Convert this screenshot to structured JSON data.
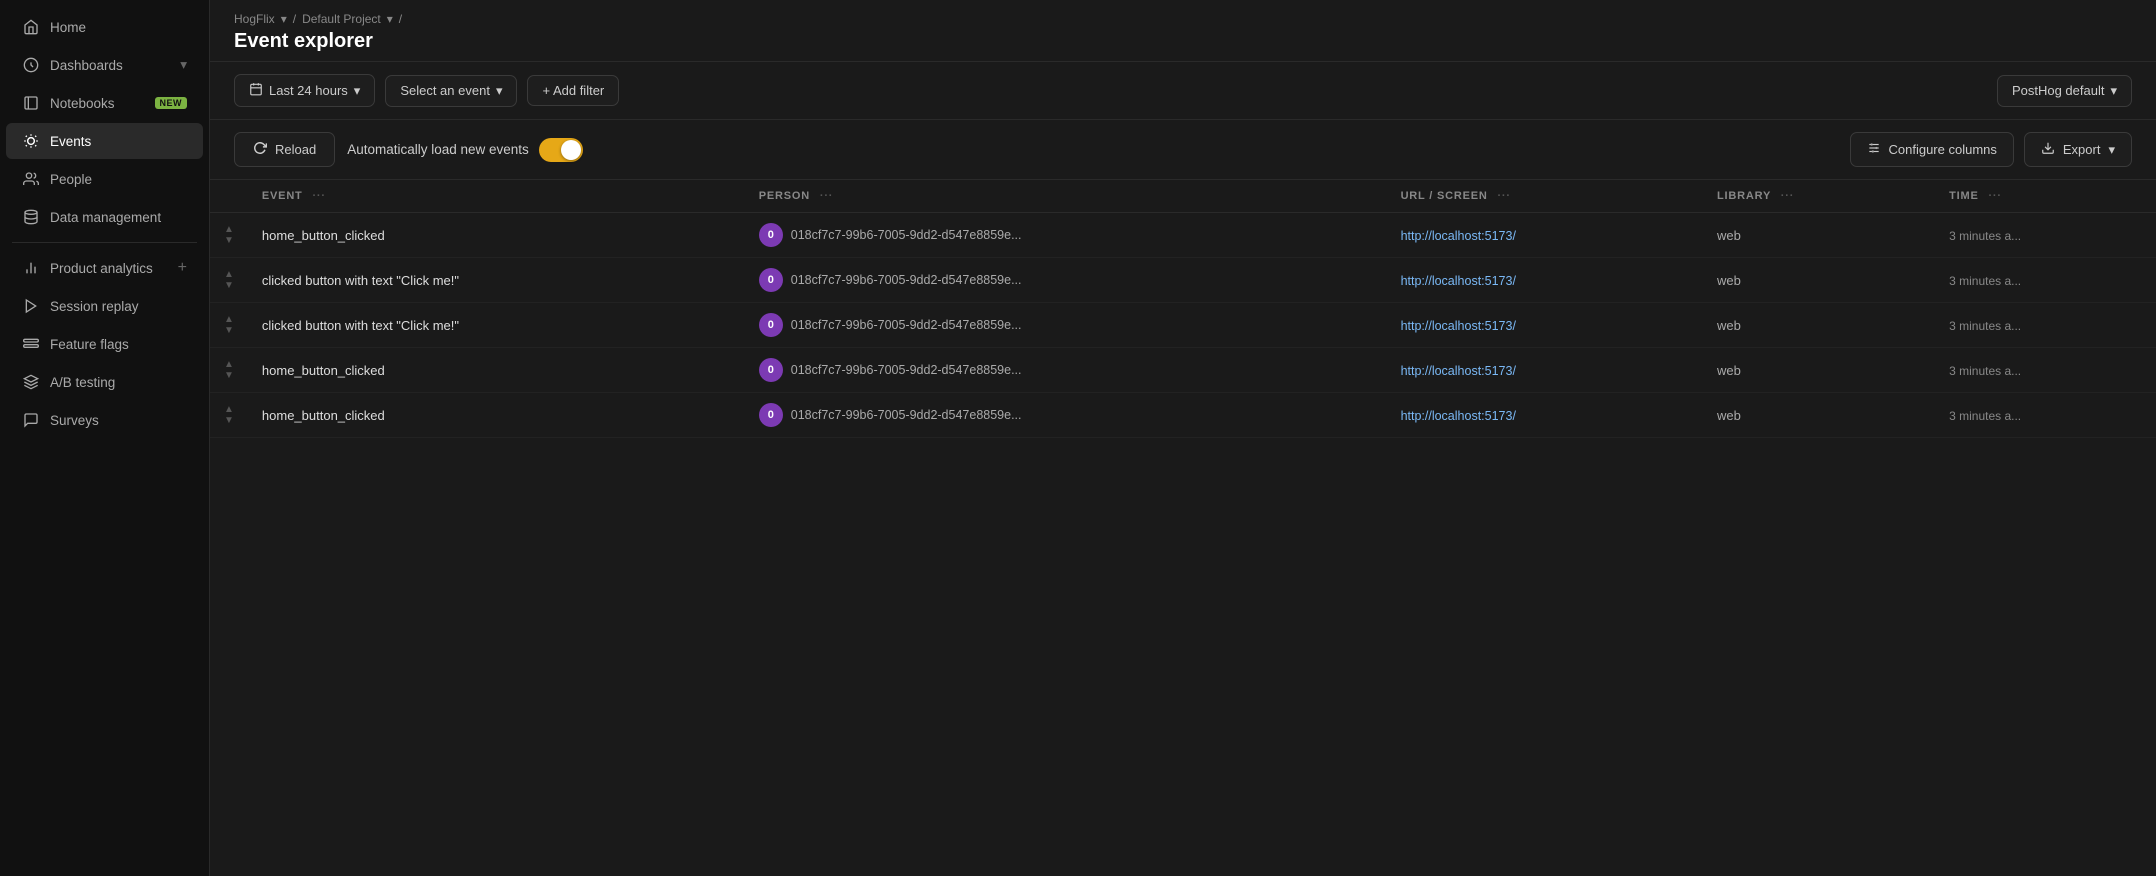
{
  "app": {
    "project": "HogFlix",
    "project_chevron": "▾",
    "default_project": "Default Project",
    "dp_chevron": "▾",
    "sep": "/",
    "page_title": "Event explorer"
  },
  "sidebar": {
    "items": [
      {
        "id": "home",
        "label": "Home",
        "icon": "home",
        "active": false
      },
      {
        "id": "dashboards",
        "label": "Dashboards",
        "icon": "dashboard",
        "chevron": "▾",
        "active": false
      },
      {
        "id": "notebooks",
        "label": "Notebooks",
        "icon": "notebook",
        "badge": "NEW",
        "active": false
      },
      {
        "id": "events",
        "label": "Events",
        "icon": "events",
        "active": true
      },
      {
        "id": "people",
        "label": "People",
        "icon": "people",
        "active": false
      },
      {
        "id": "data-management",
        "label": "Data management",
        "icon": "data",
        "active": false
      },
      {
        "id": "product-analytics",
        "label": "Product analytics",
        "icon": "analytics",
        "plus": "+",
        "active": false
      },
      {
        "id": "session-replay",
        "label": "Session replay",
        "icon": "replay",
        "active": false
      },
      {
        "id": "feature-flags",
        "label": "Feature flags",
        "icon": "flags",
        "active": false
      },
      {
        "id": "ab-testing",
        "label": "A/B testing",
        "icon": "ab",
        "active": false
      },
      {
        "id": "surveys",
        "label": "Surveys",
        "icon": "surveys",
        "active": false
      }
    ]
  },
  "toolbar": {
    "date_filter": "Last 24 hours",
    "date_chevron": "▾",
    "event_filter": "Select an event",
    "event_chevron": "▾",
    "add_filter": "+ Add filter",
    "destination": "PostHog default",
    "dest_chevron": "▾"
  },
  "action_bar": {
    "reload_label": "Reload",
    "auto_load_label": "Automatically load new events",
    "configure_label": "Configure columns",
    "export_label": "Export",
    "export_chevron": "▾"
  },
  "table": {
    "columns": [
      {
        "id": "event",
        "label": "EVENT"
      },
      {
        "id": "person",
        "label": "PERSON"
      },
      {
        "id": "url",
        "label": "URL / SCREEN"
      },
      {
        "id": "library",
        "label": "LIBRARY"
      },
      {
        "id": "time",
        "label": "TIME"
      }
    ],
    "rows": [
      {
        "event": "home_button_clicked",
        "person_id": "018cf7c7-99b6-7005-9dd2-d547e8859e...",
        "avatar_letter": "0",
        "url": "http://localhost:5173/",
        "library": "web",
        "time": "3 minutes a..."
      },
      {
        "event": "clicked button with text \"Click me!\"",
        "person_id": "018cf7c7-99b6-7005-9dd2-d547e8859e...",
        "avatar_letter": "0",
        "url": "http://localhost:5173/",
        "library": "web",
        "time": "3 minutes a..."
      },
      {
        "event": "clicked button with text \"Click me!\"",
        "person_id": "018cf7c7-99b6-7005-9dd2-d547e8859e...",
        "avatar_letter": "0",
        "url": "http://localhost:5173/",
        "library": "web",
        "time": "3 minutes a..."
      },
      {
        "event": "home_button_clicked",
        "person_id": "018cf7c7-99b6-7005-9dd2-d547e8859e...",
        "avatar_letter": "0",
        "url": "http://localhost:5173/",
        "library": "web",
        "time": "3 minutes a..."
      },
      {
        "event": "home_button_clicked",
        "person_id": "018cf7c7-99b6-7005-9dd2-d547e8859e...",
        "avatar_letter": "0",
        "url": "http://localhost:5173/",
        "library": "web",
        "time": "3 minutes a..."
      }
    ]
  }
}
